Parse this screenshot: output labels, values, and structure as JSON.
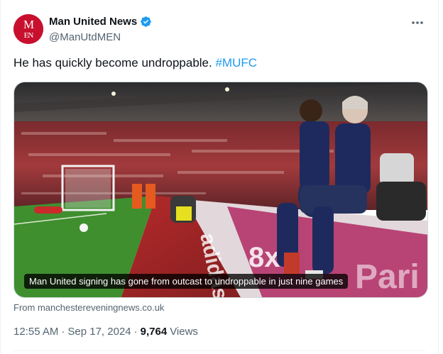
{
  "author": {
    "avatar_text": "MEN",
    "name": "Man United News",
    "handle": "@ManUtdMEN"
  },
  "tweet": {
    "text": "He has quickly become undroppable. ",
    "hashtag": "#MUFC"
  },
  "media": {
    "caption": "Man United signing has gone from outcast to undroppable in just nine games"
  },
  "source": "From manchestereveningnews.co.uk",
  "meta": {
    "time": "12:55 AM",
    "date": "Sep 17, 2024",
    "views_count": "9,764",
    "views_label": "Views"
  },
  "colors": {
    "accent": "#1d9bf0",
    "avatar": "#c8102e"
  },
  "icons": {
    "verified": "verified-badge-icon",
    "more": "more-dots-icon"
  }
}
